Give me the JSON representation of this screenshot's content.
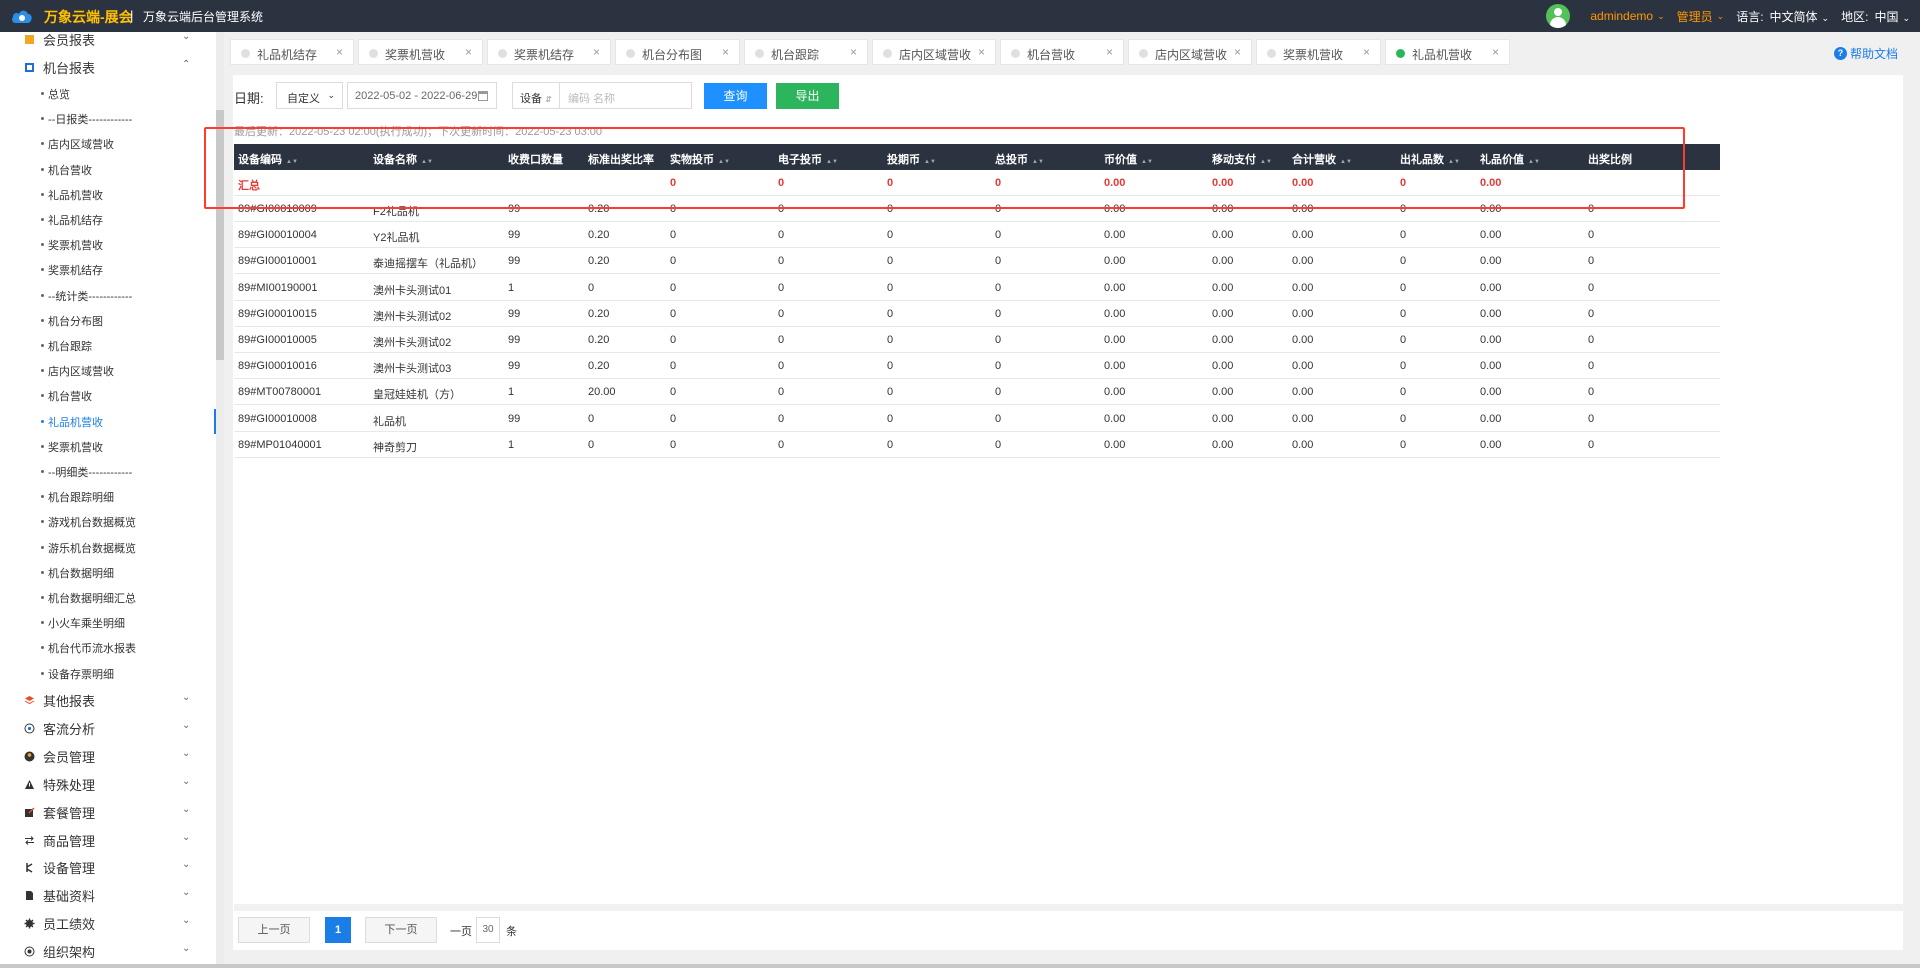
{
  "topbar": {
    "brand": "万象云端-展会",
    "separator": "|",
    "system_name": "万象云端后台管理系统",
    "username": "admindemo",
    "role": "管理员",
    "language_label": "语言:",
    "language_value": "中文简体",
    "region_label": "地区:",
    "region_value": "中国",
    "avatar_color": "#53c058",
    "brand_color": "#ffc000"
  },
  "sidebar": {
    "groups_top": [
      {
        "label": "会员报表",
        "icon": "member-report-icon",
        "expanded": false
      },
      {
        "label": "机台报表",
        "icon": "machine-report-icon",
        "expanded": true
      }
    ],
    "sub_items": [
      {
        "label": "总览",
        "active": false
      },
      {
        "label": "--日报类------------",
        "active": false
      },
      {
        "label": "店内区域营收",
        "active": false
      },
      {
        "label": "机台营收",
        "active": false
      },
      {
        "label": "礼品机营收",
        "active": false
      },
      {
        "label": "礼品机结存",
        "active": false
      },
      {
        "label": "奖票机营收",
        "active": false
      },
      {
        "label": "奖票机结存",
        "active": false
      },
      {
        "label": "--统计类------------",
        "active": false
      },
      {
        "label": "机台分布图",
        "active": false
      },
      {
        "label": "机台跟踪",
        "active": false
      },
      {
        "label": "店内区域营收",
        "active": false
      },
      {
        "label": "机台营收",
        "active": false
      },
      {
        "label": "礼品机营收",
        "active": true
      },
      {
        "label": "奖票机营收",
        "active": false
      },
      {
        "label": "--明细类------------",
        "active": false
      },
      {
        "label": "机台跟踪明细",
        "active": false
      },
      {
        "label": "游戏机台数据概览",
        "active": false
      },
      {
        "label": "游乐机台数据概览",
        "active": false
      },
      {
        "label": "机台数据明细",
        "active": false
      },
      {
        "label": "机台数据明细汇总",
        "active": false
      },
      {
        "label": "小火车乘坐明细",
        "active": false
      },
      {
        "label": "机台代币流水报表",
        "active": false
      },
      {
        "label": "设备存票明细",
        "active": false
      }
    ],
    "groups_bottom": [
      {
        "label": "其他报表",
        "icon": "layers-icon"
      },
      {
        "label": "客流分析",
        "icon": "target-icon"
      },
      {
        "label": "会员管理",
        "icon": "person-icon"
      },
      {
        "label": "特殊处理",
        "icon": "warning-icon"
      },
      {
        "label": "套餐管理",
        "icon": "edit-box-icon"
      },
      {
        "label": "商品管理",
        "icon": "swap-icon"
      },
      {
        "label": "设备管理",
        "icon": "device-icon"
      },
      {
        "label": "基础资料",
        "icon": "file-icon"
      },
      {
        "label": "员工绩效",
        "icon": "gear-icon"
      },
      {
        "label": "组织架构",
        "icon": "org-icon"
      }
    ]
  },
  "tabs": [
    {
      "label": "礼品机结存",
      "active": false
    },
    {
      "label": "奖票机营收",
      "active": false
    },
    {
      "label": "奖票机结存",
      "active": false
    },
    {
      "label": "机台分布图",
      "active": false
    },
    {
      "label": "机台跟踪",
      "active": false
    },
    {
      "label": "店内区域营收",
      "active": false
    },
    {
      "label": "机台营收",
      "active": false
    },
    {
      "label": "店内区域营收",
      "active": false
    },
    {
      "label": "奖票机营收",
      "active": false
    },
    {
      "label": "礼品机营收",
      "active": true
    }
  ],
  "help": {
    "label": "帮助文档"
  },
  "filters": {
    "date_label": "日期:",
    "date_mode": "自定义",
    "date_range": "2022-05-02 - 2022-06-29",
    "device_select": "设备",
    "device_placeholder": "编码 名称",
    "query_label": "查询",
    "export_label": "导出",
    "query_color": "#1e90ff",
    "export_color": "#2db55d"
  },
  "update_info": "最后更新：2022-05-23 02:00(执行成功)；下次更新时间：2022-05-23 03:00",
  "table": {
    "columns": [
      "设备编码",
      "设备名称",
      "收费口数量",
      "标准出奖比率",
      "实物投币",
      "电子投币",
      "投期币",
      "总投币",
      "币价值",
      "移动支付",
      "合计营收",
      "出礼品数",
      "礼品价值",
      "出奖比例"
    ],
    "sortable": [
      true,
      true,
      false,
      false,
      true,
      true,
      true,
      true,
      true,
      true,
      true,
      true,
      true,
      false
    ],
    "total_row": [
      "汇总",
      "",
      "",
      "",
      "0",
      "0",
      "0",
      "0",
      "0.00",
      "0.00",
      "0.00",
      "0",
      "0.00",
      ""
    ],
    "rows": [
      [
        "89#GI00010009",
        "F2礼品机",
        "99",
        "0.20",
        "0",
        "0",
        "0",
        "0",
        "0.00",
        "0.00",
        "0.00",
        "0",
        "0.00",
        "0"
      ],
      [
        "89#GI00010004",
        "Y2礼品机",
        "99",
        "0.20",
        "0",
        "0",
        "0",
        "0",
        "0.00",
        "0.00",
        "0.00",
        "0",
        "0.00",
        "0"
      ],
      [
        "89#GI00010001",
        "泰迪摇摆车（礼品机）",
        "99",
        "0.20",
        "0",
        "0",
        "0",
        "0",
        "0.00",
        "0.00",
        "0.00",
        "0",
        "0.00",
        "0"
      ],
      [
        "89#MI00190001",
        "澳州卡头测试01",
        "1",
        "0",
        "0",
        "0",
        "0",
        "0",
        "0.00",
        "0.00",
        "0.00",
        "0",
        "0.00",
        "0"
      ],
      [
        "89#GI00010015",
        "澳州卡头测试02",
        "99",
        "0.20",
        "0",
        "0",
        "0",
        "0",
        "0.00",
        "0.00",
        "0.00",
        "0",
        "0.00",
        "0"
      ],
      [
        "89#GI00010005",
        "澳州卡头测试02",
        "99",
        "0.20",
        "0",
        "0",
        "0",
        "0",
        "0.00",
        "0.00",
        "0.00",
        "0",
        "0.00",
        "0"
      ],
      [
        "89#GI00010016",
        "澳州卡头测试03",
        "99",
        "0.20",
        "0",
        "0",
        "0",
        "0",
        "0.00",
        "0.00",
        "0.00",
        "0",
        "0.00",
        "0"
      ],
      [
        "89#MT00780001",
        "皇冠娃娃机（方）",
        "1",
        "20.00",
        "0",
        "0",
        "0",
        "0",
        "0.00",
        "0.00",
        "0.00",
        "0",
        "0.00",
        "0"
      ],
      [
        "89#GI00010008",
        "礼品机",
        "99",
        "0",
        "0",
        "0",
        "0",
        "0",
        "0.00",
        "0.00",
        "0.00",
        "0",
        "0.00",
        "0"
      ],
      [
        "89#MP01040001",
        "神奇剪刀",
        "1",
        "0",
        "0",
        "0",
        "0",
        "0",
        "0.00",
        "0.00",
        "0.00",
        "0",
        "0.00",
        "0"
      ]
    ],
    "header_bg": "#2b3240",
    "total_color": "#e53935"
  },
  "highlight": {
    "color": "#ff3b30"
  },
  "pagination": {
    "prev_label": "上一页",
    "current_page": "1",
    "next_label": "下一页",
    "per_page_label": "一页",
    "page_size": "30",
    "per_page_unit": "条"
  }
}
